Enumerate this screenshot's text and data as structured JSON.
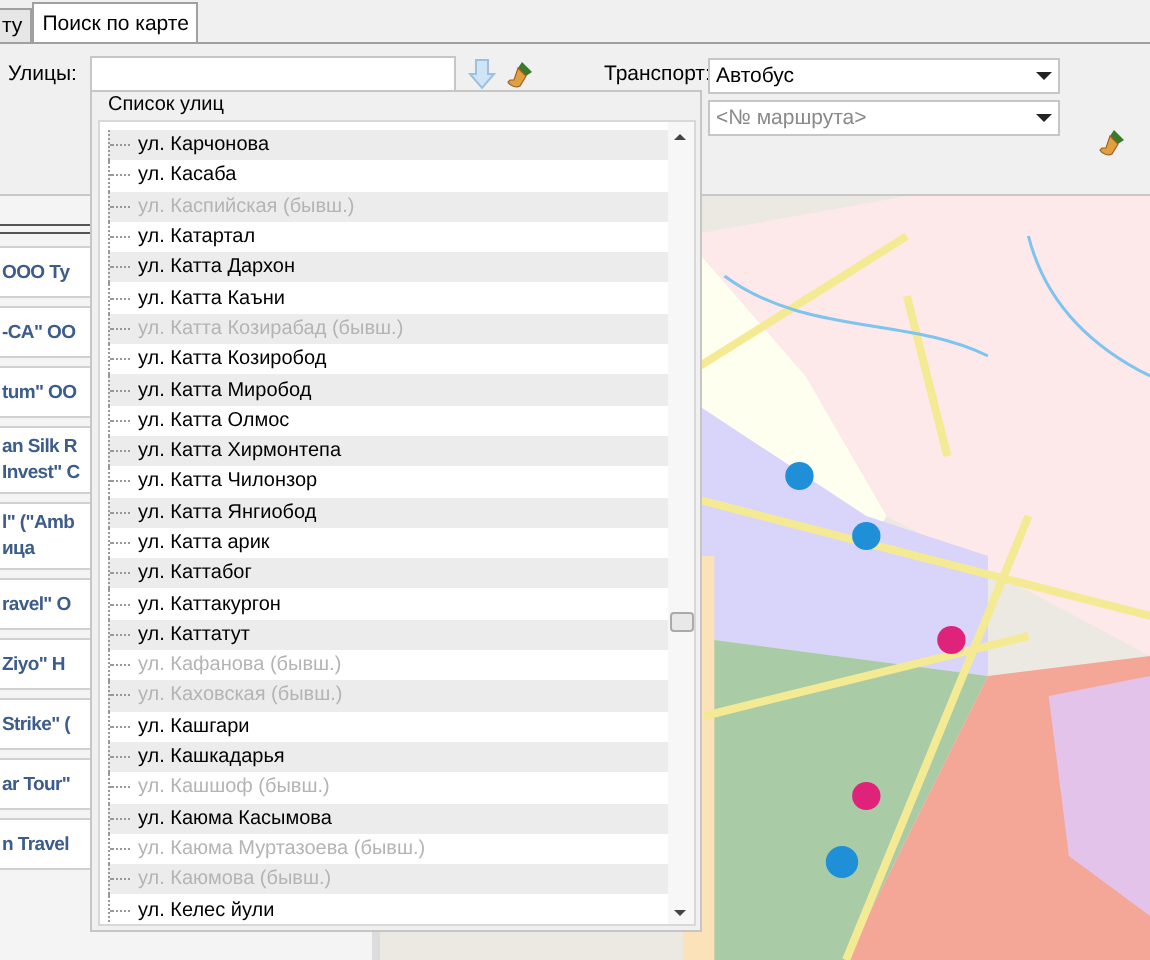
{
  "tabs": [
    {
      "label": "ту",
      "selected": false
    },
    {
      "label": "Поиск по карте",
      "selected": true
    }
  ],
  "streets_label": "Улицы:",
  "transport_label": "Транспорт:",
  "transport_select": {
    "value": "Автобус"
  },
  "route_select": {
    "placeholder": "<№ маршрута>"
  },
  "left_cards": [
    {
      "lines": [
        "ООО Ту"
      ]
    },
    {
      "lines": [
        "-CA\" OO"
      ]
    },
    {
      "lines": [
        "tum\" OO"
      ]
    },
    {
      "lines": [
        "an Silk R",
        "Invest\" C"
      ]
    },
    {
      "lines": [
        "l\" (\"Amb",
        "ица"
      ]
    },
    {
      "lines": [
        "ravel\" O"
      ]
    },
    {
      "lines": [
        "Ziyo\" H"
      ]
    },
    {
      "lines": [
        "Strike\" ("
      ]
    },
    {
      "lines": [
        "ar Tour\""
      ]
    },
    {
      "lines": [
        "n Travel"
      ]
    }
  ],
  "street_list": {
    "title": "Список улиц",
    "items": [
      {
        "label": "ул. Карчонова",
        "disabled": false
      },
      {
        "label": "ул. Касаба",
        "disabled": false
      },
      {
        "label": "ул. Каспийская (бывш.)",
        "disabled": true
      },
      {
        "label": "ул. Катартал",
        "disabled": false
      },
      {
        "label": "ул. Катта Дархон",
        "disabled": false
      },
      {
        "label": "ул. Катта Каъни",
        "disabled": false
      },
      {
        "label": "ул. Катта Козирабад (бывш.)",
        "disabled": true
      },
      {
        "label": "ул. Катта Козиробод",
        "disabled": false
      },
      {
        "label": "ул. Катта Миробод",
        "disabled": false
      },
      {
        "label": "ул. Катта Олмос",
        "disabled": false
      },
      {
        "label": "ул. Катта Хирмонтепа",
        "disabled": false
      },
      {
        "label": "ул. Катта Чилонзор",
        "disabled": false
      },
      {
        "label": "ул. Катта Янгиобод",
        "disabled": false
      },
      {
        "label": "ул. Катта арик",
        "disabled": false
      },
      {
        "label": "ул. Каттабог",
        "disabled": false
      },
      {
        "label": "ул. Каттакургон",
        "disabled": false
      },
      {
        "label": "ул. Каттатут",
        "disabled": false
      },
      {
        "label": "ул. Кафанова (бывш.)",
        "disabled": true
      },
      {
        "label": "ул. Каховская (бывш.)",
        "disabled": true
      },
      {
        "label": "ул. Кашгари",
        "disabled": false
      },
      {
        "label": "ул. Кашкадарья",
        "disabled": false
      },
      {
        "label": "ул. Кашшоф (бывш.)",
        "disabled": true
      },
      {
        "label": "ул. Каюма Касымова",
        "disabled": false
      },
      {
        "label": "ул. Каюма Муртазоева (бывш.)",
        "disabled": true
      },
      {
        "label": "ул. Каюмова (бывш.)",
        "disabled": true
      },
      {
        "label": "ул. Келес йули",
        "disabled": false
      }
    ]
  }
}
